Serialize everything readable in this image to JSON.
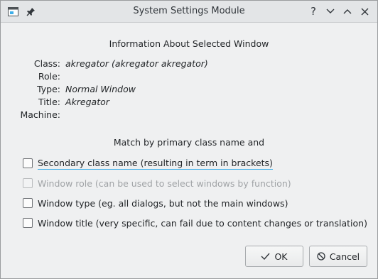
{
  "window": {
    "title": "System Settings Module"
  },
  "titlebar_buttons": {
    "help": "?",
    "minimize": "⌄",
    "maximize": "⌃",
    "close": "✕"
  },
  "info": {
    "heading": "Information About Selected Window",
    "rows": [
      {
        "label": "Class:",
        "value": "akregator (akregator akregator)"
      },
      {
        "label": "Role:",
        "value": ""
      },
      {
        "label": "Type:",
        "value": "Normal Window"
      },
      {
        "label": "Title:",
        "value": "Akregator"
      },
      {
        "label": "Machine:",
        "value": ""
      }
    ]
  },
  "match": {
    "heading": "Match by primary class name and",
    "options": [
      {
        "label": "Secondary class name  (resulting in term in brackets)",
        "checked": false,
        "enabled": true,
        "focused": true
      },
      {
        "label": "Window role (can be used to select windows by function)",
        "checked": false,
        "enabled": false
      },
      {
        "label": "Window type (eg. all dialogs, but not the main windows)",
        "checked": false,
        "enabled": true
      },
      {
        "label": "Window title (very specific, can fail due to content changes or translation)",
        "checked": false,
        "enabled": true
      }
    ]
  },
  "buttons": {
    "ok": "OK",
    "cancel": "Cancel"
  },
  "colors": {
    "focus_accent": "#3daee9",
    "window_bg": "#eff0f1"
  }
}
